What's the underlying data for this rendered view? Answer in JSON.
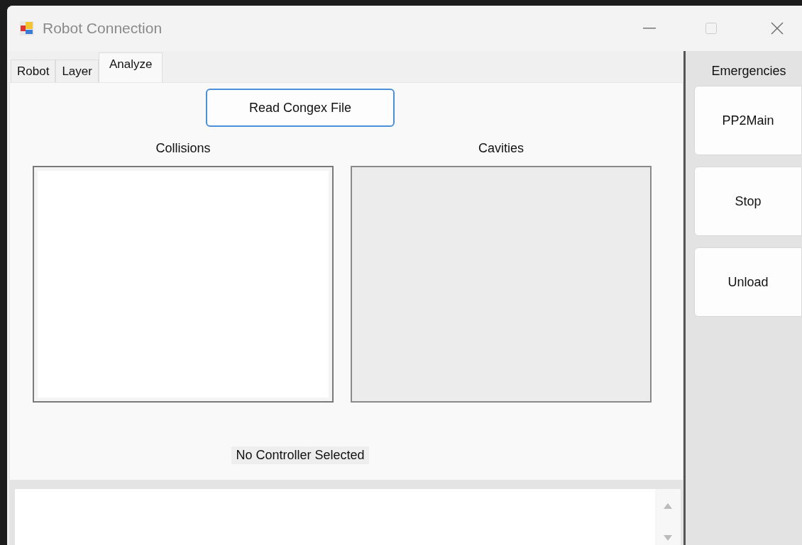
{
  "window": {
    "title": "Robot Connection"
  },
  "tabs": [
    {
      "label": "Robot",
      "selected": false
    },
    {
      "label": "Layer",
      "selected": false
    },
    {
      "label": "Analyze",
      "selected": true
    }
  ],
  "read_button": "Read Congex File",
  "lists": [
    {
      "label": "Collisions",
      "kind": "listbox"
    },
    {
      "label": "Cavities",
      "kind": "panel"
    }
  ],
  "status": "No Controller Selected",
  "emergencies": {
    "title": "Emergencies",
    "buttons": [
      "PP2Main",
      "Stop",
      "Unload"
    ]
  }
}
